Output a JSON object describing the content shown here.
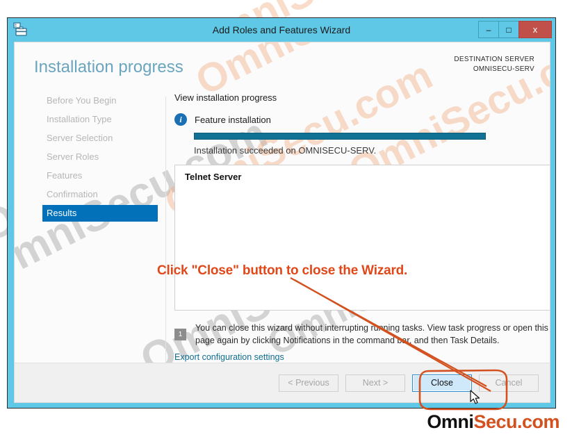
{
  "window": {
    "title": "Add Roles and Features Wizard",
    "icon": "server-wizard-icon",
    "controls": {
      "minimize": "–",
      "maximize": "□",
      "close": "x"
    }
  },
  "header": {
    "page_title": "Installation progress",
    "destination_label": "DESTINATION SERVER",
    "destination_server": "OMNISECU-SERV"
  },
  "sidebar": {
    "items": [
      {
        "label": "Before You Begin",
        "active": false
      },
      {
        "label": "Installation Type",
        "active": false
      },
      {
        "label": "Server Selection",
        "active": false
      },
      {
        "label": "Server Roles",
        "active": false
      },
      {
        "label": "Features",
        "active": false
      },
      {
        "label": "Confirmation",
        "active": false
      },
      {
        "label": "Results",
        "active": true
      }
    ]
  },
  "main": {
    "view_label": "View installation progress",
    "info_icon_glyph": "i",
    "feature_label": "Feature installation",
    "progress_percent": 100,
    "progress_status": "Installation succeeded on OMNISECU-SERV.",
    "result_item": "Telnet Server",
    "flag_badge_count": "1",
    "note_text": "You can close this wizard without interrupting running tasks. View task progress or open this page again by clicking Notifications in the command bar, and then Task Details.",
    "export_link": "Export configuration settings"
  },
  "footer": {
    "buttons": [
      {
        "label": "< Previous",
        "enabled": false
      },
      {
        "label": "Next >",
        "enabled": false
      },
      {
        "label": "Close",
        "enabled": true
      },
      {
        "label": "Cancel",
        "enabled": false
      }
    ]
  },
  "annotation": {
    "text": "Click \"Close\" button to close the Wizard.",
    "color": "#e0481a"
  },
  "brand": {
    "part1": "Omni",
    "part2": "Secu.com",
    "color1": "#111111",
    "color2": "#d2511e"
  },
  "watermark": {
    "text": "OmniSecu.com",
    "gray": "#878787",
    "peach": "#f3a87e"
  },
  "colors": {
    "titlebar": "#5ec8e6",
    "accent_nav": "#0271b9",
    "progress": "#117296",
    "close_btn": "#c1504a",
    "link": "#0f6e92"
  }
}
